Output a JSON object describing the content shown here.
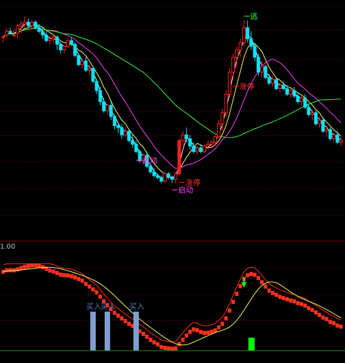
{
  "colors": {
    "background": "#000000",
    "grid": "#8b0000",
    "up": "#ff2020",
    "down": "#00e5ff",
    "ma_fast": "#ffffff",
    "ma_mid": "#ffff66",
    "ma_slow": "#ff44ff",
    "ma_long": "#33ff33",
    "signal_bar": "#7f9fcf",
    "green_bar": "#00ff00",
    "osc_red": "#ff3020",
    "osc_yellow": "#ffff55",
    "annotation_red": "#ff3333",
    "annotation_magenta": "#ff44ff",
    "annotation_green": "#33ff33",
    "annotation_blue": "#5a78c8"
  },
  "chart_data": [
    {
      "type": "candlestick",
      "panel": "price",
      "grid": true,
      "ylim": [
        0,
        100
      ],
      "candles": [
        [
          83,
          84,
          80,
          83
        ],
        [
          84,
          88,
          82,
          86
        ],
        [
          86,
          88,
          84,
          85
        ],
        [
          84,
          87,
          83,
          84
        ],
        [
          85,
          90,
          82,
          89
        ],
        [
          89,
          92,
          85,
          90
        ],
        [
          90,
          94,
          88,
          91
        ],
        [
          91,
          93,
          88,
          89
        ],
        [
          89,
          92,
          87,
          91
        ],
        [
          91,
          92,
          88,
          88
        ],
        [
          88,
          90,
          85,
          86
        ],
        [
          86,
          88,
          82,
          84
        ],
        [
          84,
          86,
          80,
          81
        ],
        [
          81,
          84,
          79,
          82
        ],
        [
          82,
          85,
          80,
          83
        ],
        [
          83,
          84,
          76,
          79
        ],
        [
          79,
          80,
          74,
          76
        ],
        [
          76,
          79,
          74,
          78
        ],
        [
          78,
          82,
          77,
          81
        ],
        [
          81,
          83,
          78,
          79
        ],
        [
          79,
          80,
          72,
          73
        ],
        [
          73,
          74,
          67,
          68
        ],
        [
          68,
          71,
          66,
          70
        ],
        [
          70,
          72,
          64,
          65
        ],
        [
          65,
          68,
          62,
          66
        ],
        [
          66,
          67,
          58,
          59
        ],
        [
          59,
          60,
          52,
          54
        ],
        [
          54,
          56,
          46,
          48
        ],
        [
          48,
          50,
          42,
          43
        ],
        [
          43,
          47,
          41,
          46
        ],
        [
          46,
          48,
          38,
          40
        ],
        [
          40,
          41,
          33,
          35
        ],
        [
          35,
          37,
          31,
          34
        ],
        [
          34,
          36,
          28,
          30
        ],
        [
          30,
          34,
          29,
          32
        ],
        [
          32,
          33,
          26,
          27
        ],
        [
          27,
          30,
          23,
          25
        ],
        [
          25,
          27,
          20,
          21
        ],
        [
          21,
          22,
          15,
          16
        ],
        [
          16,
          20,
          14,
          19
        ],
        [
          19,
          21,
          12,
          13
        ],
        [
          13,
          14,
          9,
          10
        ],
        [
          10,
          12,
          7,
          8
        ],
        [
          8,
          9,
          6,
          7
        ],
        [
          7,
          8,
          4,
          5
        ],
        [
          5,
          10,
          4,
          9
        ],
        [
          9,
          10,
          6,
          7
        ],
        [
          7,
          8,
          4,
          6
        ],
        [
          6,
          10,
          4,
          9
        ],
        [
          9,
          28,
          8,
          27
        ],
        [
          27,
          32,
          24,
          30
        ],
        [
          30,
          34,
          26,
          28
        ],
        [
          28,
          30,
          22,
          24
        ],
        [
          24,
          26,
          20,
          21
        ],
        [
          21,
          24,
          19,
          23
        ],
        [
          23,
          25,
          20,
          21
        ],
        [
          21,
          25,
          20,
          24
        ],
        [
          24,
          27,
          22,
          25
        ],
        [
          25,
          27,
          23,
          26
        ],
        [
          26,
          30,
          24,
          29
        ],
        [
          29,
          38,
          28,
          36
        ],
        [
          36,
          44,
          32,
          42
        ],
        [
          42,
          54,
          40,
          52
        ],
        [
          52,
          66,
          50,
          64
        ],
        [
          64,
          74,
          60,
          72
        ],
        [
          72,
          78,
          66,
          76
        ],
        [
          76,
          82,
          72,
          80
        ],
        [
          80,
          92,
          78,
          88
        ],
        [
          88,
          92,
          80,
          82
        ],
        [
          82,
          86,
          76,
          78
        ],
        [
          78,
          80,
          70,
          72
        ],
        [
          72,
          74,
          62,
          64
        ],
        [
          64,
          70,
          61,
          67
        ],
        [
          67,
          68,
          60,
          61
        ],
        [
          61,
          63,
          57,
          58
        ],
        [
          58,
          62,
          56,
          60
        ],
        [
          60,
          61,
          54,
          55
        ],
        [
          55,
          58,
          53,
          57
        ],
        [
          57,
          59,
          54,
          55
        ],
        [
          55,
          57,
          51,
          52
        ],
        [
          52,
          55,
          50,
          54
        ],
        [
          54,
          56,
          50,
          51
        ],
        [
          51,
          53,
          47,
          48
        ],
        [
          48,
          51,
          46,
          50
        ],
        [
          50,
          52,
          44,
          45
        ],
        [
          45,
          47,
          40,
          41
        ],
        [
          41,
          44,
          38,
          42
        ],
        [
          42,
          43,
          35,
          36
        ],
        [
          36,
          40,
          34,
          38
        ],
        [
          38,
          39,
          31,
          32
        ],
        [
          32,
          35,
          29,
          33
        ],
        [
          33,
          34,
          27,
          28
        ],
        [
          28,
          31,
          26,
          30
        ],
        [
          30,
          32,
          25,
          26
        ],
        [
          26,
          29,
          24,
          27
        ]
      ],
      "annotations": [
        {
          "text": "启动",
          "color": "magenta",
          "candle": 37
        },
        {
          "text": "涨停",
          "color": "red",
          "candle": 49
        },
        {
          "text": "启动",
          "color": "magenta",
          "candle": 47
        },
        {
          "text": "涨停",
          "color": "red",
          "candle": 64
        },
        {
          "text": "逃",
          "color": "green",
          "candle": 67
        }
      ]
    },
    {
      "type": "indicator",
      "panel": "oscillator",
      "grid": true,
      "ylim": [
        0,
        100
      ],
      "top_label": "1.00",
      "signal_label": "买入",
      "signal_candles": [
        25,
        29,
        37
      ],
      "green_bar_candle": 69,
      "arrow_candle": 67
    }
  ]
}
